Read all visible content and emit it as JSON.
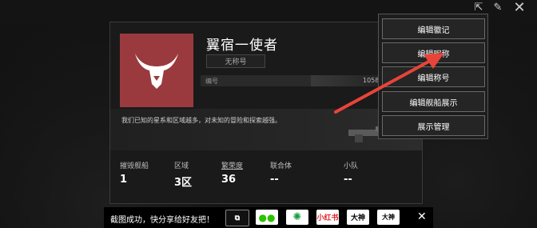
{
  "top_bar": {
    "icons": [
      "share-icon",
      "edit-icon",
      "close-icon"
    ]
  },
  "profile": {
    "name": "翼宿一使者",
    "title_badge": "无称号",
    "id_label": "编号",
    "id_value": "1058",
    "description": "我们已知的星系和区域越多，对未知的冒险和探索越强。",
    "emblem_color": "#9b3a3e"
  },
  "stats": [
    {
      "label": "摧毁舰船",
      "value": "1"
    },
    {
      "label": "区域",
      "value": "3区"
    },
    {
      "label": "繁荣度",
      "value": "36"
    },
    {
      "label": "联合体",
      "value": "--"
    },
    {
      "label": "小队",
      "value": "--"
    }
  ],
  "menu": {
    "items": [
      "编辑徽记",
      "编辑昵称",
      "编辑称号",
      "编辑舰船展示",
      "展示管理"
    ]
  },
  "share_bar": {
    "text": "截图成功，快分享给好友把！",
    "buttons": [
      "screenshot-icon",
      "wechat-icon",
      "moments-icon",
      "小红书",
      "大神",
      "大神"
    ],
    "close": "✕"
  },
  "colors": {
    "arrow": "#e8443a",
    "accent_red": "#e0242a"
  }
}
